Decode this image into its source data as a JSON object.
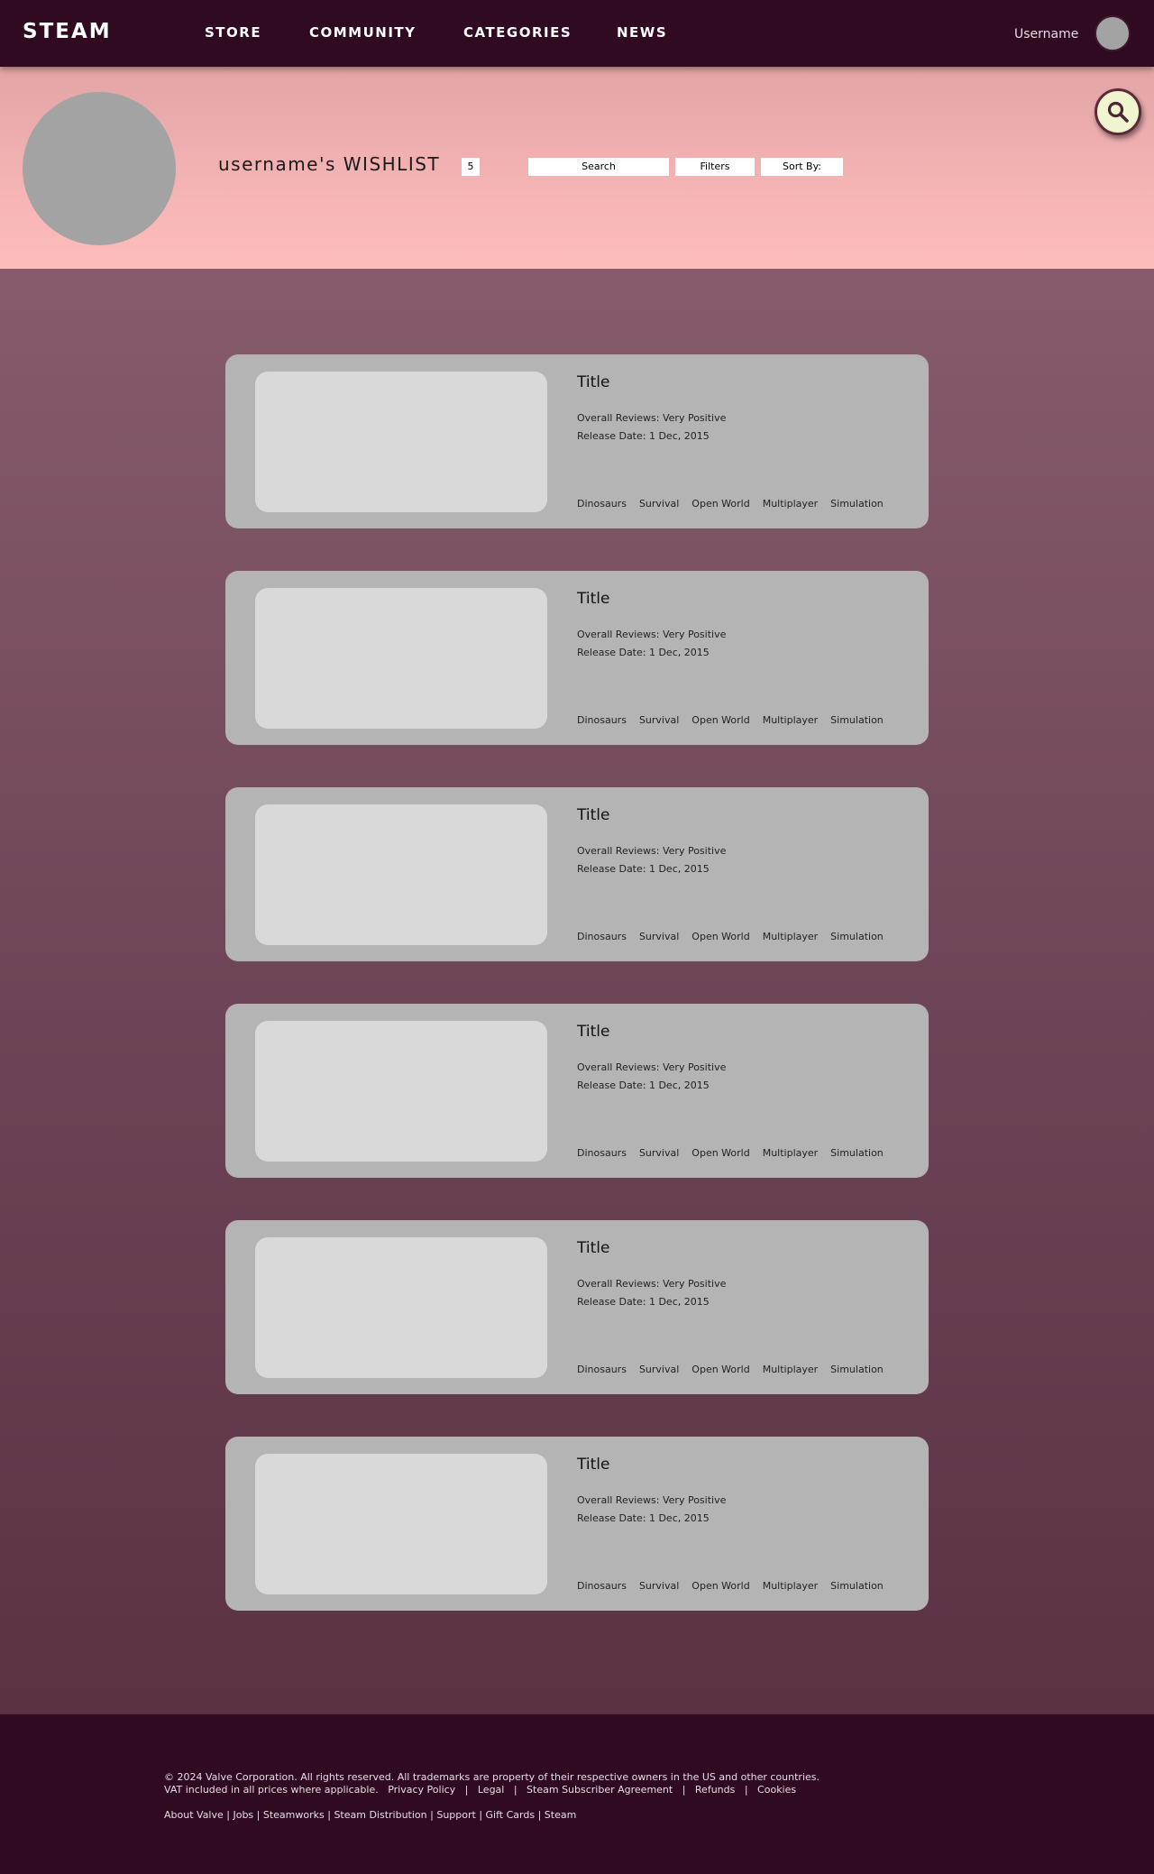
{
  "nav": {
    "brand": "STEAM",
    "links": [
      "STORE",
      "COMMUNITY",
      "CATEGORIES",
      "NEWS"
    ],
    "username": "Username"
  },
  "header": {
    "wishlist_title": "username's WISHLIST",
    "wishlist_count": "5",
    "search_label": "Search",
    "filters_label": "Filters",
    "sort_label": "Sort By:"
  },
  "cards": [
    {
      "title": "Title",
      "reviews": "Overall Reviews: Very Positive",
      "release": "Release Date: 1 Dec, 2015",
      "tags": [
        "Dinosaurs",
        "Survival",
        "Open World",
        "Multiplayer",
        "Simulation"
      ]
    },
    {
      "title": "Title",
      "reviews": "Overall Reviews: Very Positive",
      "release": "Release Date: 1 Dec, 2015",
      "tags": [
        "Dinosaurs",
        "Survival",
        "Open World",
        "Multiplayer",
        "Simulation"
      ]
    },
    {
      "title": "Title",
      "reviews": "Overall Reviews: Very Positive",
      "release": "Release Date: 1 Dec, 2015",
      "tags": [
        "Dinosaurs",
        "Survival",
        "Open World",
        "Multiplayer",
        "Simulation"
      ]
    },
    {
      "title": "Title",
      "reviews": "Overall Reviews: Very Positive",
      "release": "Release Date: 1 Dec, 2015",
      "tags": [
        "Dinosaurs",
        "Survival",
        "Open World",
        "Multiplayer",
        "Simulation"
      ]
    },
    {
      "title": "Title",
      "reviews": "Overall Reviews: Very Positive",
      "release": "Release Date: 1 Dec, 2015",
      "tags": [
        "Dinosaurs",
        "Survival",
        "Open World",
        "Multiplayer",
        "Simulation"
      ]
    },
    {
      "title": "Title",
      "reviews": "Overall Reviews: Very Positive",
      "release": "Release Date: 1 Dec, 2015",
      "tags": [
        "Dinosaurs",
        "Survival",
        "Open World",
        "Multiplayer",
        "Simulation"
      ]
    }
  ],
  "footer": {
    "copyright": "© 2024 Valve Corporation. All rights reserved. All trademarks are property of their respective owners in the US and other countries.",
    "vat_links": [
      "VAT included in all prices where applicable.",
      "Privacy Policy",
      "Legal",
      "Steam Subscriber Agreement",
      "Refunds",
      "Cookies"
    ],
    "bottom_links": [
      "About Valve",
      "Jobs",
      "Steamworks",
      "Steam Distribution",
      "Support",
      "Gift Cards",
      "Steam"
    ]
  },
  "icons": {
    "search_fab": "search-icon"
  },
  "colors": {
    "nav_bg": "#2f0a20",
    "header_bg": "#fdbdbb",
    "main_bg": "#865c6c",
    "card_bg": "#b4b4b4",
    "image_placeholder": "#d9d9d9"
  }
}
